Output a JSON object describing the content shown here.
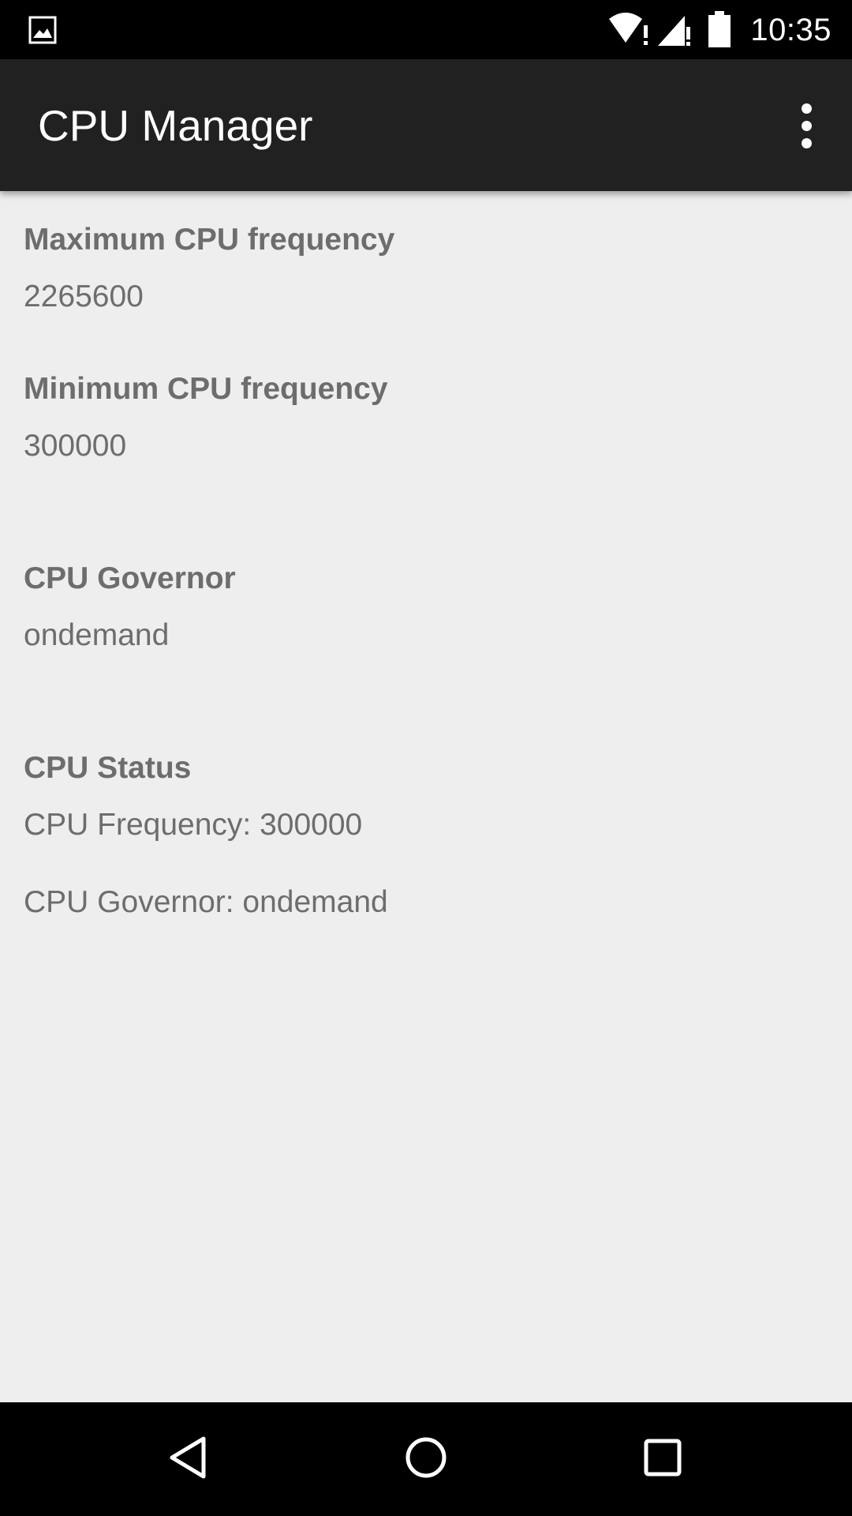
{
  "status_bar": {
    "time": "10:35",
    "icons": [
      "image-notification-icon",
      "wifi-icon",
      "cell-signal-icon",
      "battery-icon"
    ]
  },
  "app_bar": {
    "title": "CPU Manager",
    "overflow_icon": "more-vert-icon"
  },
  "settings": {
    "max_freq": {
      "label": "Maximum CPU frequency",
      "value": "2265600"
    },
    "min_freq": {
      "label": "Minimum CPU frequency",
      "value": "300000"
    },
    "governor": {
      "label": "CPU Governor",
      "value": "ondemand"
    }
  },
  "cpu_status": {
    "label": "CPU Status",
    "frequency_line": "CPU Frequency: 300000",
    "governor_line": "CPU Governor: ondemand"
  },
  "nav_bar": {
    "icons": [
      "back-icon",
      "home-icon",
      "recents-icon"
    ]
  },
  "colors": {
    "status_bar": "#000000",
    "app_bar": "#212121",
    "background": "#eeeeee",
    "text": "#6d6d6d"
  }
}
